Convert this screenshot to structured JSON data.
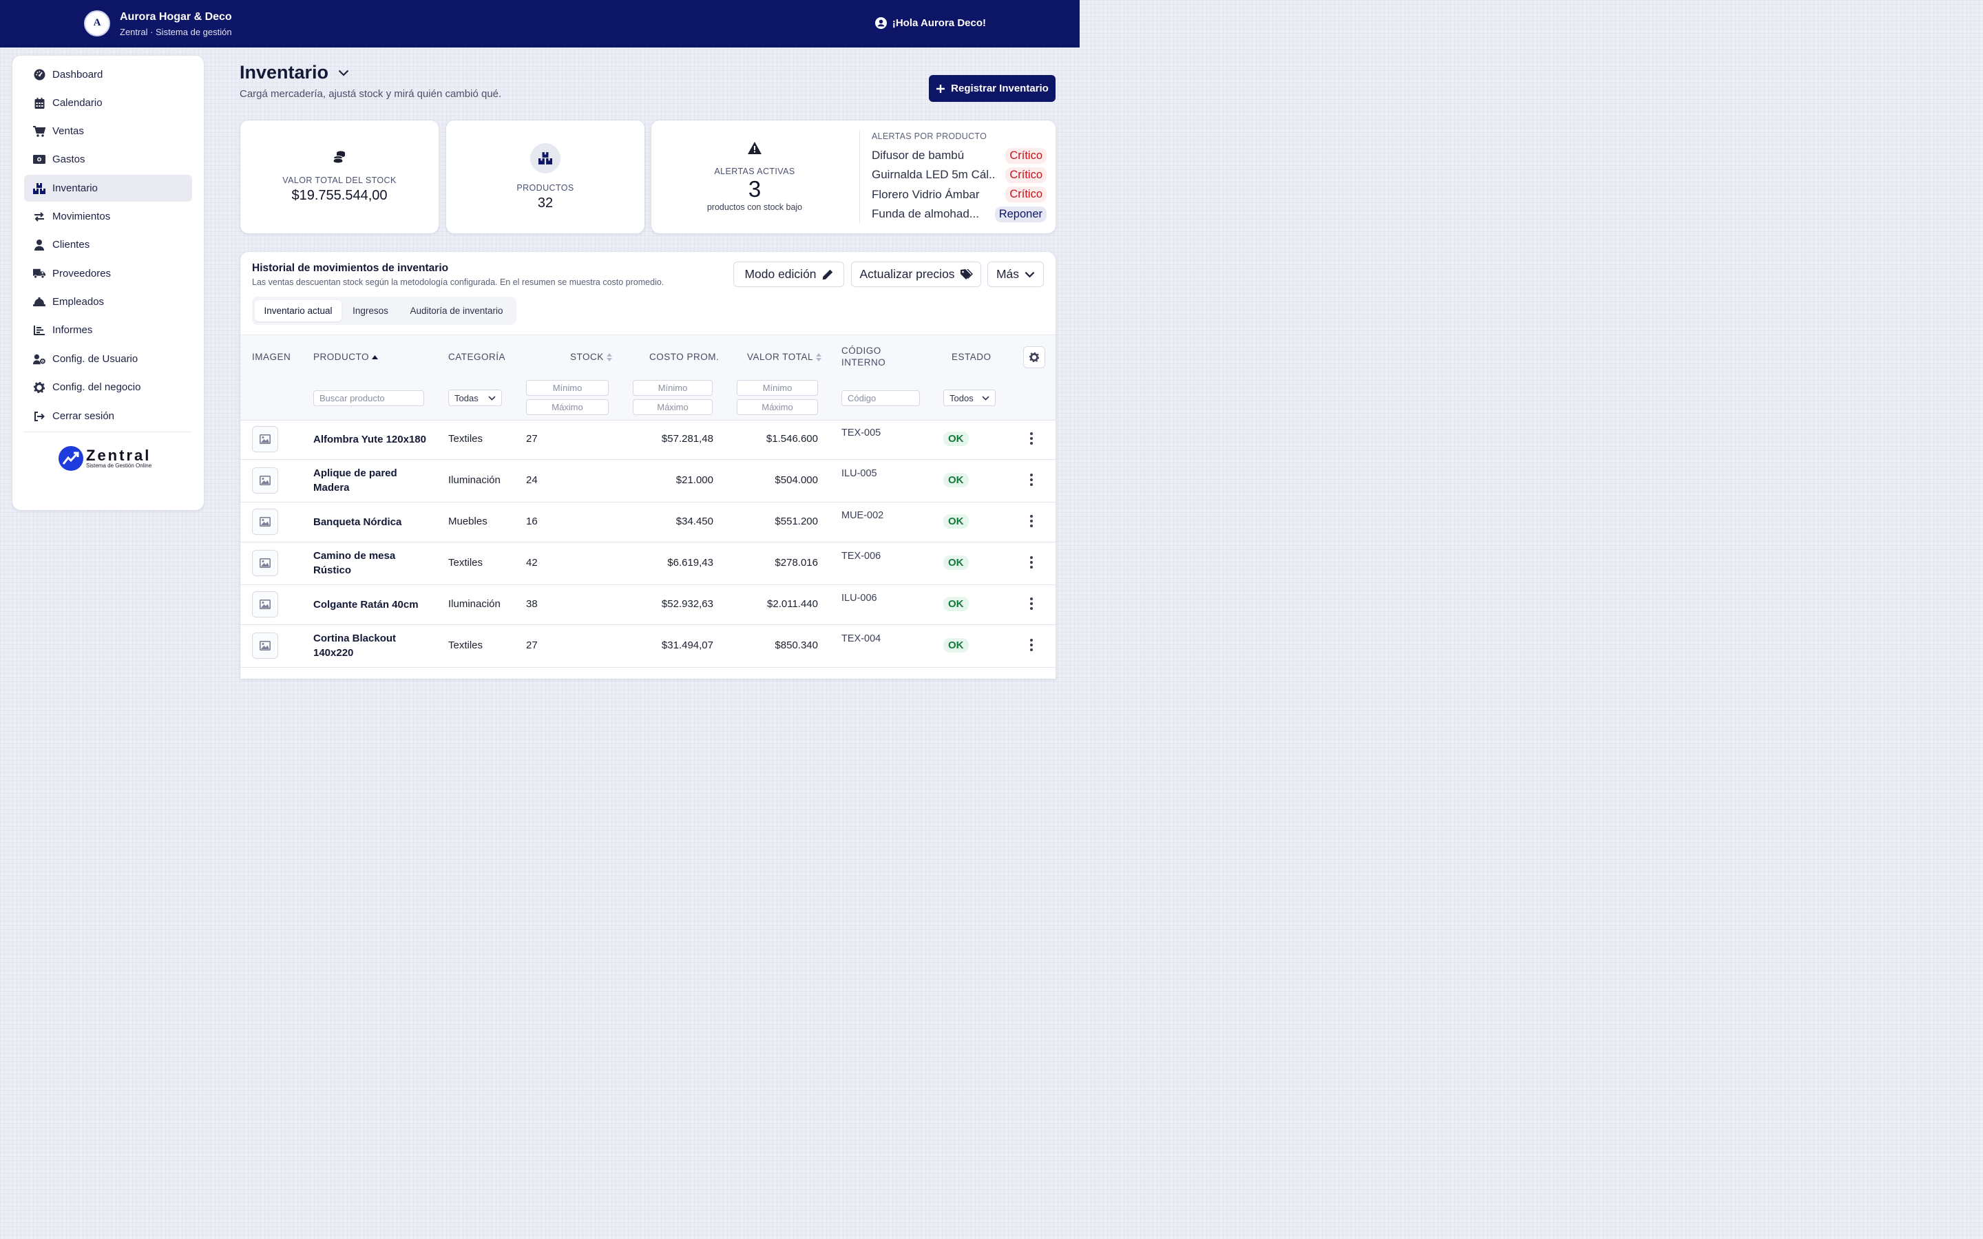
{
  "header": {
    "logo_letter": "A",
    "brand_name": "Aurora Hogar & Deco",
    "brand_sub": "Zentral · Sistema de gestión",
    "greeting": "¡Hola Aurora Deco!"
  },
  "sidebar": {
    "items": [
      {
        "label": "Dashboard",
        "icon": "gauge-icon"
      },
      {
        "label": "Calendario",
        "icon": "calendar-icon"
      },
      {
        "label": "Ventas",
        "icon": "cart-icon"
      },
      {
        "label": "Gastos",
        "icon": "money-icon"
      },
      {
        "label": "Inventario",
        "icon": "boxes-icon",
        "active": true
      },
      {
        "label": "Movimientos",
        "icon": "arrows-icon"
      },
      {
        "label": "Clientes",
        "icon": "user-icon"
      },
      {
        "label": "Proveedores",
        "icon": "truck-icon"
      },
      {
        "label": "Empleados",
        "icon": "hardhat-icon"
      },
      {
        "label": "Informes",
        "icon": "chart-icon"
      },
      {
        "label": "Config. de Usuario",
        "icon": "user-gear-icon"
      },
      {
        "label": "Config. del negocio",
        "icon": "gear-icon"
      },
      {
        "label": "Cerrar sesión",
        "icon": "logout-icon"
      }
    ],
    "logo_word": "Zentral",
    "logo_tagline": "Sistema de Gestión Online"
  },
  "page": {
    "title": "Inventario",
    "subtitle": "Cargá mercadería, ajustá stock y mirá quién cambió qué.",
    "primary_button": "Registrar Inventario"
  },
  "kpis": {
    "stock_value_label": "VALOR TOTAL DEL STOCK",
    "stock_value": "$19.755.544,00",
    "products_label": "PRODUCTOS",
    "products_value": "32",
    "alerts_label": "ALERTAS ACTIVAS",
    "alerts_value": "3",
    "alerts_caption": "productos con stock bajo",
    "alerts_by_product_title": "ALERTAS POR PRODUCTO",
    "alerts_by_product": [
      {
        "name": "Difusor de bambú",
        "status": "Crítico",
        "color": "#c0151c"
      },
      {
        "name": "Guirnalda LED 5m Cál...",
        "status": "Crítico",
        "color": "#c0151c"
      },
      {
        "name": "Florero Vidrio Ámbar",
        "status": "Crítico",
        "color": "#c0151c"
      },
      {
        "name": "Funda de almohad...",
        "status": "Reponer",
        "color": "#0d1566"
      }
    ]
  },
  "panel": {
    "title": "Historial de movimientos de inventario",
    "subtitle": "Las ventas descuentan stock según la metodología configurada. En el resumen se muestra costo promedio.",
    "edit_button": "Modo edición",
    "prices_button": "Actualizar precios",
    "more_button": "Más",
    "tabs": [
      "Inventario actual",
      "Ingresos",
      "Auditoría de inventario"
    ],
    "active_tab": 0
  },
  "table": {
    "columns": {
      "image": "IMAGEN",
      "product": "PRODUCTO",
      "category": "CATEGORÍA",
      "stock": "STOCK",
      "avg_cost": "COSTO PROM.",
      "total_value": "VALOR TOTAL",
      "code_line1": "CÓDIGO",
      "code_line2": "INTERNO",
      "status": "ESTADO"
    },
    "filters": {
      "product_placeholder": "Buscar producto",
      "category_value": "Todas",
      "min_placeholder": "Mínimo",
      "max_placeholder": "Máximo",
      "code_placeholder": "Código",
      "status_value": "Todos"
    },
    "rows": [
      {
        "product": "Alfombra Yute 120x180",
        "category": "Textiles",
        "stock": "27",
        "avg_cost": "$57.281,48",
        "total": "$1.546.600",
        "code": "TEX-005",
        "status": "OK"
      },
      {
        "product": "Aplique de pared Madera",
        "category": "Iluminación",
        "stock": "24",
        "avg_cost": "$21.000",
        "total": "$504.000",
        "code": "ILU-005",
        "status": "OK"
      },
      {
        "product": "Banqueta Nórdica",
        "category": "Muebles",
        "stock": "16",
        "avg_cost": "$34.450",
        "total": "$551.200",
        "code": "MUE-002",
        "status": "OK"
      },
      {
        "product": "Camino de mesa Rústico",
        "category": "Textiles",
        "stock": "42",
        "avg_cost": "$6.619,43",
        "total": "$278.016",
        "code": "TEX-006",
        "status": "OK"
      },
      {
        "product": "Colgante Ratán 40cm",
        "category": "Iluminación",
        "stock": "38",
        "avg_cost": "$52.932,63",
        "total": "$2.011.440",
        "code": "ILU-006",
        "status": "OK"
      },
      {
        "product": "Cortina Blackout 140x220",
        "category": "Textiles",
        "stock": "27",
        "avg_cost": "$31.494,07",
        "total": "$850.340",
        "code": "TEX-004",
        "status": "OK"
      }
    ]
  },
  "colors": {
    "brand": "#0d1566",
    "ok": "#147a3a",
    "critical": "#c0151c"
  }
}
